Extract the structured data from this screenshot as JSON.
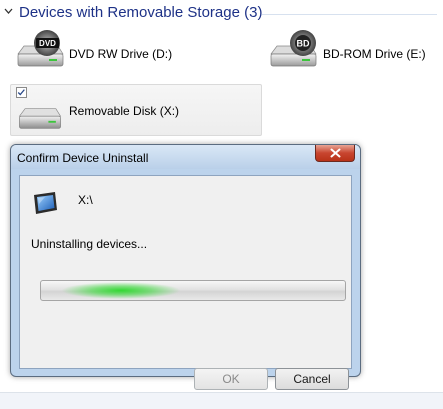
{
  "explorer": {
    "section_title": "Devices with Removable Storage (3)",
    "drives": [
      {
        "label": "DVD RW Drive (D:)",
        "icon": "dvd-drive-icon",
        "badge": "DVD"
      },
      {
        "label": "BD-ROM Drive (E:)",
        "icon": "bd-drive-icon",
        "badge": "BD"
      },
      {
        "label": "Removable Disk (X:)",
        "icon": "removable-disk-icon",
        "checkbox_glyph": "✓"
      }
    ]
  },
  "dialog": {
    "title": "Confirm Device Uninstall",
    "close_glyph": "✕",
    "device_name": "X:\\",
    "device_icon": "device-monitor-icon",
    "status": "Uninstalling devices...",
    "ok_label": "OK",
    "cancel_label": "Cancel"
  },
  "colors": {
    "section_title": "#1e3287",
    "progress_glow": "#2ad82a",
    "close_button": "#c8452f",
    "dialog_frame": "#bcd3ec"
  }
}
